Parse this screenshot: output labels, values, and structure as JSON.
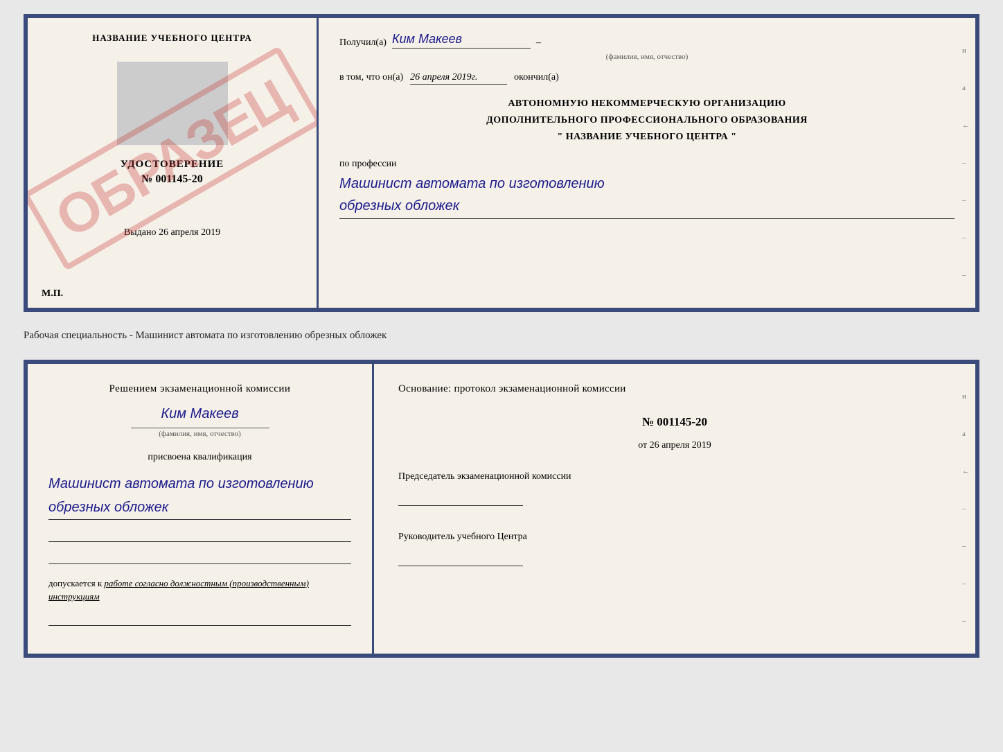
{
  "top_doc": {
    "left": {
      "school_name": "НАЗВАНИЕ УЧЕБНОГО ЦЕНТРА",
      "watermark": "ОБРАЗЕЦ",
      "udostoverenie": "УДОСТОВЕРЕНИЕ",
      "number": "№ 001145-20",
      "vydano_label": "Выдано",
      "vydano_date": "26 апреля 2019",
      "mp": "М.П."
    },
    "right": {
      "poluchil_label": "Получил(а)",
      "poluchil_name": "Ким Макеев",
      "fio_sub": "(фамилия, имя, отчество)",
      "vtom_label": "в том, что он(а)",
      "vtom_date": "26 апреля 2019г.",
      "okonchil": "окончил(а)",
      "avto_line1": "АВТОНОМНУЮ НЕКОММЕРЧЕСКУЮ ОРГАНИЗАЦИЮ",
      "avto_line2": "ДОПОЛНИТЕЛЬНОГО ПРОФЕССИОНАЛЬНОГО ОБРАЗОВАНИЯ",
      "avto_line3": "\" НАЗВАНИЕ УЧЕБНОГО ЦЕНТРА \"",
      "po_professii": "по профессии",
      "profession1": "Машинист автомата по изготовлению",
      "profession2": "обрезных обложек",
      "side_marks": [
        "и",
        "а",
        "←",
        "–",
        "–",
        "–",
        "–"
      ]
    }
  },
  "middle_text": "Рабочая специальность - Машинист автомата по изготовлению обрезных обложек",
  "bottom_doc": {
    "left": {
      "resheniem": "Решением экзаменационной комиссии",
      "kim_makeev": "Ким Макеев",
      "fio_sub": "(фамилия, имя, отчество)",
      "prisvoena": "присвоена квалификация",
      "kvalif1": "Машинист автомата по изготовлению",
      "kvalif2": "обрезных обложек",
      "dopuskaetsya": "допускается к",
      "dopusk_italic": "работе согласно должностным (производственным) инструкциям"
    },
    "right": {
      "osnovanie": "Основание: протокол экзаменационной комиссии",
      "protocol_number": "№ 001145-20",
      "protocol_date_label": "от",
      "protocol_date": "26 апреля 2019",
      "predsedatel": "Председатель экзаменационной комиссии",
      "rukovoditel": "Руководитель учебного Центра",
      "side_marks": [
        "и",
        "а",
        "←",
        "–",
        "–",
        "–",
        "–"
      ]
    }
  }
}
